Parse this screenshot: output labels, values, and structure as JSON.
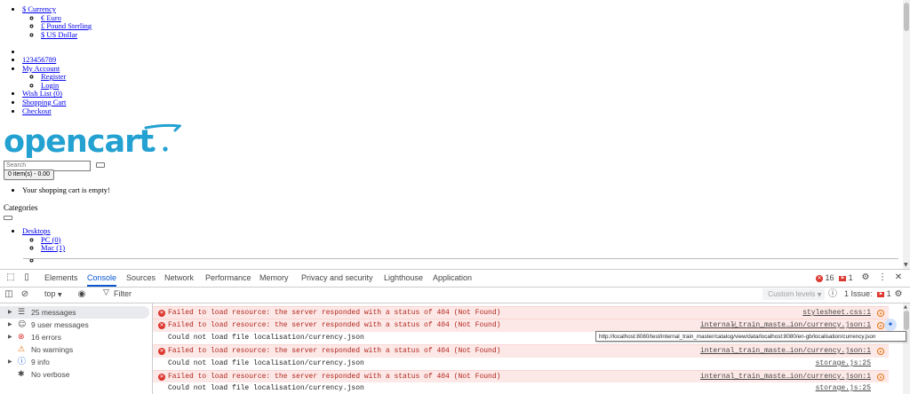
{
  "page": {
    "currency": {
      "toggle": "$ Currency",
      "options": [
        "€ Euro",
        "£ Pound Sterling",
        "$ US Dollar"
      ]
    },
    "top_links": {
      "phone": "123456789",
      "account": "My Account",
      "account_items": [
        "Register",
        "Login"
      ],
      "wishlist": "Wish List (0)",
      "cart": "Shopping Cart",
      "checkout": "Checkout"
    },
    "logo_text": "opencart",
    "search_placeholder": "Search",
    "cart_button": "0 item(s) - 0.00",
    "cart_empty": "Your shopping cart is empty!",
    "categories_title": "Categories",
    "menu": {
      "desktops": "Desktops",
      "sub": [
        "PC (0)",
        "Mac (1)"
      ]
    }
  },
  "devtools": {
    "tabs": [
      "Elements",
      "Console",
      "Sources",
      "Network",
      "Performance",
      "Memory",
      "Privacy and security",
      "Lighthouse",
      "Application"
    ],
    "active_tab": "Console",
    "error_count": "16",
    "issue_flag_count": "1",
    "context": "top",
    "filter_placeholder": "Filter",
    "levels": "Custom levels",
    "issues_label": "1 Issue:",
    "issues_count": "1",
    "sidebar": [
      {
        "icon": "list-icon",
        "label": "25 messages"
      },
      {
        "icon": "user-icon",
        "label": "9 user messages"
      },
      {
        "icon": "error-icon",
        "label": "16 errors"
      },
      {
        "icon": "warning-icon",
        "label": "No warnings"
      },
      {
        "icon": "info-icon",
        "label": "9 info"
      },
      {
        "icon": "bug-icon",
        "label": "No verbose"
      }
    ],
    "logs": [
      {
        "type": "error",
        "text": "Failed to load resource: the server responded with a status of 404 (Not Found)",
        "source": "stylesheet.css:1"
      },
      {
        "type": "error",
        "text": "Failed to load resource: the server responded with a status of 404 (Not Found)",
        "source": "internal_train_maste…ion/currency.json:1"
      },
      {
        "type": "plain",
        "text": "Could not load file localisation/currency.json",
        "source": ""
      },
      {
        "type": "error",
        "text": "Failed to load resource: the server responded with a status of 404 (Not Found)",
        "source": "internal_train_maste…ion/currency.json:1"
      },
      {
        "type": "plain",
        "text": "Could not load file localisation/currency.json",
        "source": "storage.js:25"
      },
      {
        "type": "error",
        "text": "Failed to load resource: the server responded with a status of 404 (Not Found)",
        "source": "internal_train_maste…ion/currency.json:1"
      },
      {
        "type": "plain",
        "text": "Could not load file localisation/currency.json",
        "source": "storage.js:25"
      }
    ],
    "tooltip": "http://localhost:8080/test/internal_train_master/catalog/view/data/localhost:8080/en-gb/localisation/currency.json"
  },
  "colors": {
    "link": "#0000ee",
    "logo": "#23a1d1",
    "active_tab": "#0b57d0",
    "error_text": "#b3261e",
    "error_bg": "#fce8e6",
    "error_badge": "#dc362e"
  }
}
